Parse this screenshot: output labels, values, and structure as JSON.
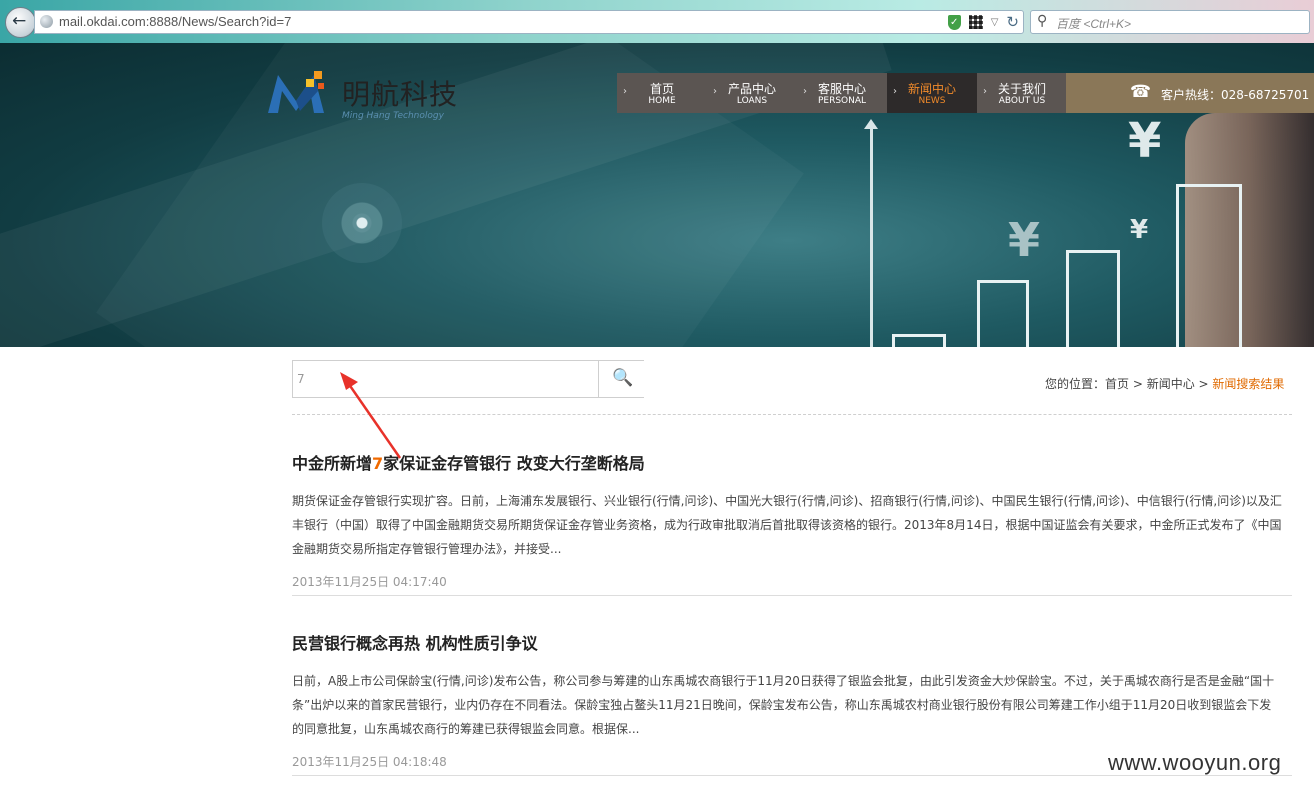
{
  "browser": {
    "url": "mail.okdai.com:8888/News/Search?id=7",
    "search_placeholder": "百度 <Ctrl+K>",
    "back_label": "←",
    "search_icon": "search-icon"
  },
  "header": {
    "logo_cn": "明航科技",
    "logo_en": "Ming Hang Technology",
    "nav": [
      {
        "zh": "首页",
        "en": "HOME"
      },
      {
        "zh": "产品中心",
        "en": "LOANS"
      },
      {
        "zh": "客服中心",
        "en": "PERSONAL"
      },
      {
        "zh": "新闻中心",
        "en": "NEWS",
        "active": true
      },
      {
        "zh": "关于我们",
        "en": "ABOUT US"
      }
    ],
    "hotline": "客户热线：028-68725701"
  },
  "search": {
    "value": "7"
  },
  "breadcrumb": {
    "prefix": "您的位置：",
    "home": "首页",
    "sep1": " > ",
    "section": "新闻中心",
    "sep2": " > ",
    "current": "新闻搜索结果"
  },
  "articles": [
    {
      "title_before": "中金所新增",
      "title_highlight": "7",
      "title_after": "家保证金存管银行 改变大行垄断格局",
      "summary": "期货保证金存管银行实现扩容。日前，上海浦东发展银行、兴业银行(行情,问诊)、中国光大银行(行情,问诊)、招商银行(行情,问诊)、中国民生银行(行情,问诊)、中信银行(行情,问诊)以及汇丰银行（中国）取得了中国金融期货交易所期货保证金存管业务资格，成为行政审批取消后首批取得该资格的银行。2013年8月14日，根据中国证监会有关要求，中金所正式发布了《中国金融期货交易所指定存管银行管理办法》，并接受...",
      "date": "2013年11月25日 04:17:40"
    },
    {
      "title": "民营银行概念再热 机构性质引争议",
      "summary": "日前，A股上市公司保龄宝(行情,问诊)发布公告，称公司参与筹建的山东禹城农商银行于11月20日获得了银监会批复，由此引发资金大炒保龄宝。不过，关于禹城农商行是否是金融“国十条”出炉以来的首家民营银行，业内仍存在不同看法。保龄宝独占鳌头11月21日晚间，保龄宝发布公告，称山东禹城农村商业银行股份有限公司筹建工作小组于11月20日收到银监会下发的同意批复，山东禹城农商行的筹建已获得银监会同意。根据保...",
      "date": "2013年11月25日 04:18:48"
    }
  ],
  "watermark": "www.wooyun.org",
  "colors": {
    "accent": "#f06a00",
    "nav_bg": "#5b5552",
    "nav_active_bg": "#2d2a2a",
    "hotline_bg": "#8a7758"
  }
}
